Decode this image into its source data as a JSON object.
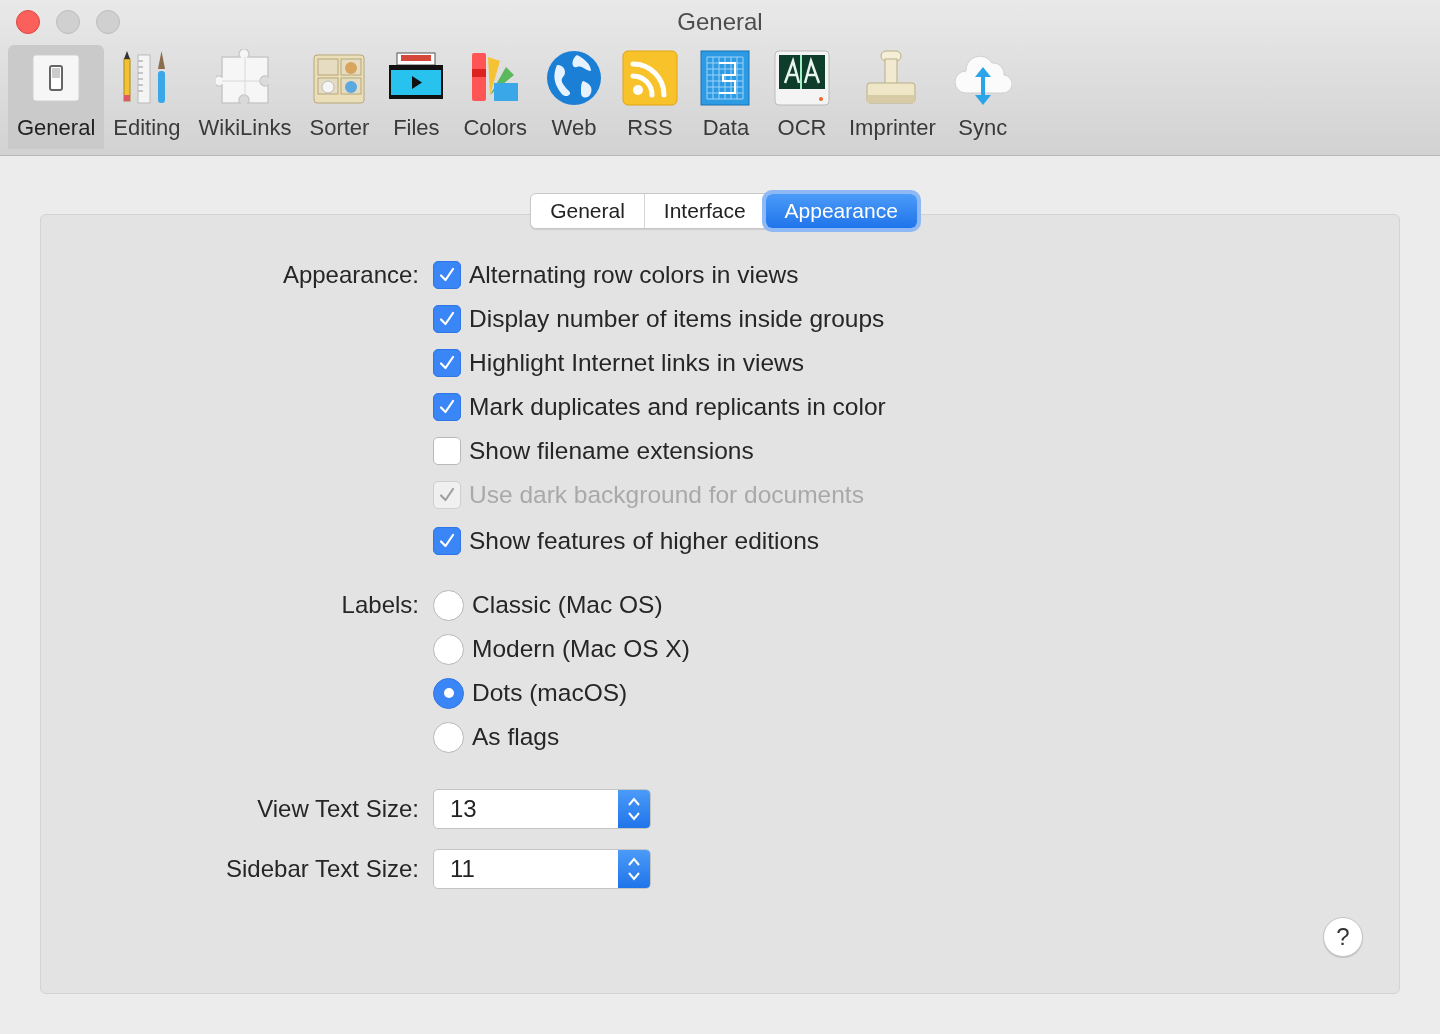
{
  "window": {
    "title": "General"
  },
  "toolbar": [
    {
      "label": "General",
      "selected": true
    },
    {
      "label": "Editing",
      "selected": false
    },
    {
      "label": "WikiLinks",
      "selected": false
    },
    {
      "label": "Sorter",
      "selected": false
    },
    {
      "label": "Files",
      "selected": false
    },
    {
      "label": "Colors",
      "selected": false
    },
    {
      "label": "Web",
      "selected": false
    },
    {
      "label": "RSS",
      "selected": false
    },
    {
      "label": "Data",
      "selected": false
    },
    {
      "label": "OCR",
      "selected": false
    },
    {
      "label": "Imprinter",
      "selected": false
    },
    {
      "label": "Sync",
      "selected": false
    }
  ],
  "tabs": [
    {
      "label": "General",
      "selected": false
    },
    {
      "label": "Interface",
      "selected": false
    },
    {
      "label": "Appearance",
      "selected": true
    }
  ],
  "appearance": {
    "label": "Appearance:",
    "options": [
      {
        "label": "Alternating row colors in views",
        "checked": true,
        "disabled": false
      },
      {
        "label": "Display number of items inside groups",
        "checked": true,
        "disabled": false
      },
      {
        "label": "Highlight Internet links in views",
        "checked": true,
        "disabled": false
      },
      {
        "label": "Mark duplicates and replicants in color",
        "checked": true,
        "disabled": false
      },
      {
        "label": "Show filename extensions",
        "checked": false,
        "disabled": false
      },
      {
        "label": "Use dark background for documents",
        "checked": true,
        "disabled": true
      },
      {
        "label": "Show features of higher editions",
        "checked": true,
        "disabled": false
      }
    ]
  },
  "labels": {
    "label": "Labels:",
    "options": [
      {
        "label": "Classic (Mac OS)",
        "selected": false
      },
      {
        "label": "Modern (Mac OS X)",
        "selected": false
      },
      {
        "label": "Dots (macOS)",
        "selected": true
      },
      {
        "label": "As flags",
        "selected": false
      }
    ]
  },
  "text_sizes": [
    {
      "label": "View Text Size:",
      "value": "13"
    },
    {
      "label": "Sidebar Text Size:",
      "value": "11"
    }
  ],
  "help": "?"
}
